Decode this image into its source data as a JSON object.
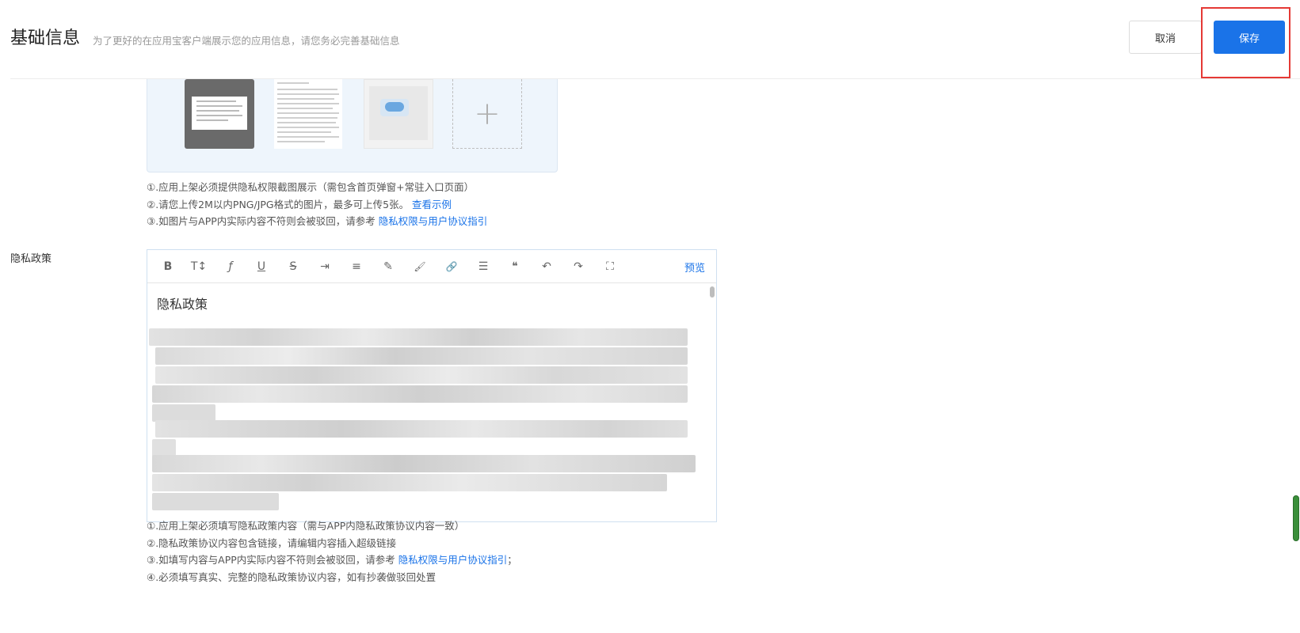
{
  "header": {
    "title": "基础信息",
    "subtitle": "为了更好的在应用宝客户端展示您的应用信息，请您务必完善基础信息",
    "cancel_label": "取消",
    "save_label": "保存"
  },
  "screenshots": {
    "add_glyph": "+",
    "notes": [
      {
        "text": "①.应用上架必须提供隐私权限截图展示（需包含首页弹窗+常驻入口页面）",
        "link": ""
      },
      {
        "text": "②.请您上传2M以内PNG/JPG格式的图片，最多可上传5张。 ",
        "link": "查看示例"
      },
      {
        "text": "③.如图片与APP内实际内容不符则会被驳回，请参考 ",
        "link": "隐私权限与用户协议指引"
      }
    ]
  },
  "privacy": {
    "label": "隐私政策",
    "toolbar": [
      {
        "name": "bold-icon",
        "glyph": "B"
      },
      {
        "name": "text-size-icon",
        "glyph": "T↕"
      },
      {
        "name": "font-icon",
        "glyph": "ƒ"
      },
      {
        "name": "underline-icon",
        "glyph": "U"
      },
      {
        "name": "strikethrough-icon",
        "glyph": "S"
      },
      {
        "name": "indent-icon",
        "glyph": "⇥"
      },
      {
        "name": "line-height-icon",
        "glyph": "≡"
      },
      {
        "name": "highlighter-icon",
        "glyph": "✎"
      },
      {
        "name": "brush-icon",
        "glyph": "🖌"
      },
      {
        "name": "link-icon",
        "glyph": "🔗"
      },
      {
        "name": "align-icon",
        "glyph": "☰"
      },
      {
        "name": "quote-icon",
        "glyph": "❝"
      },
      {
        "name": "undo-icon",
        "glyph": "↶"
      },
      {
        "name": "redo-icon",
        "glyph": "↷"
      },
      {
        "name": "fullscreen-icon",
        "glyph": "⛶"
      }
    ],
    "preview_label": "预览",
    "content_heading": "隐私政策",
    "notes": [
      {
        "text": "①.应用上架必须填写隐私政策内容（需与APP内隐私政策协议内容一致）",
        "link": "",
        "suffix": ""
      },
      {
        "text": "②.隐私政策协议内容包含链接，请编辑内容插入超级链接",
        "link": "",
        "suffix": ""
      },
      {
        "text": "③.如填写内容与APP内实际内容不符则会被驳回，请参考 ",
        "link": "隐私权限与用户协议指引",
        "suffix": "；"
      },
      {
        "text": "④.必须填写真实、完整的隐私政策协议内容，如有抄袭做驳回处置",
        "link": "",
        "suffix": ""
      }
    ]
  },
  "colors": {
    "accent": "#1a73e8",
    "highlight": "#e53935"
  }
}
